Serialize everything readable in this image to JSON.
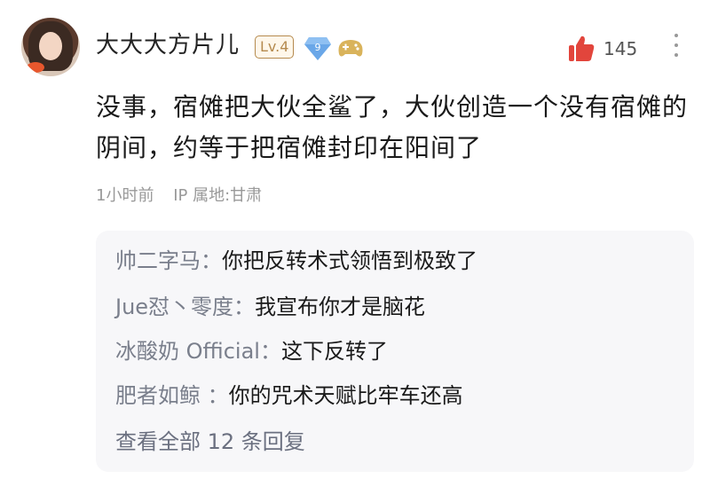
{
  "post": {
    "username": "大大大方片儿",
    "level": "Lv.4",
    "badge_number": "9",
    "like_count": "145",
    "content": "没事，宿傩把大伙全鲨了，大伙创造一个没有宿傩的阴间，约等于把宿傩封印在阳间了",
    "time": "1小时前",
    "ip_location": "IP 属地:甘肃"
  },
  "replies": [
    {
      "name": "帅二字马：",
      "text": "你把反转术式领悟到极致了"
    },
    {
      "name": "Jue怼丶零度：",
      "text": "我宣布你才是脑花"
    },
    {
      "name": "冰酸奶 Official：",
      "text": "这下反转了"
    },
    {
      "name": "肥者如鲸 ：",
      "text": "你的咒术天赋比牢车还高"
    }
  ],
  "view_all": "查看全部 12 条回复",
  "colors": {
    "level_gold": "#b58a4e",
    "diamond_blue": "#6aa7e8",
    "like_red": "#e2453c",
    "reply_bg": "#f7f7f9"
  },
  "icons": [
    "avatar",
    "diamond-badge-icon",
    "game-controller-icon",
    "thumb-up-icon",
    "more-vertical-icon"
  ]
}
